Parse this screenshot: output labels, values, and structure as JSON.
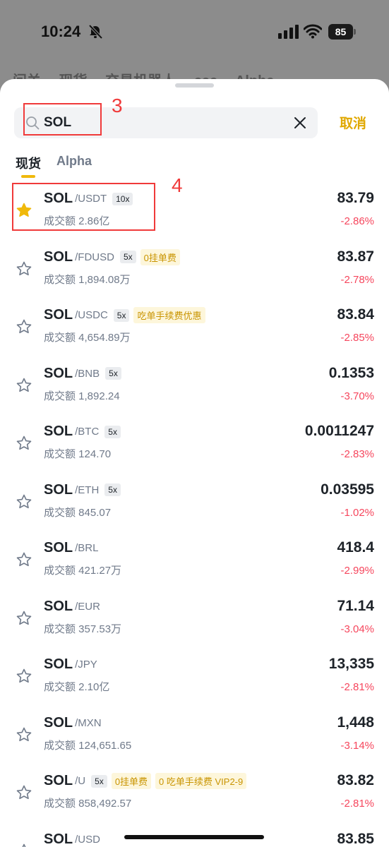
{
  "status_bar": {
    "time": "10:24",
    "battery": "85"
  },
  "background_tabs": [
    "问关",
    "现货",
    "交易机器人",
    "ccc",
    "Alpha"
  ],
  "search": {
    "value": "SOL",
    "placeholder": "",
    "cancel_label": "取消"
  },
  "annotations": {
    "search_marker": "3",
    "first_row_marker": "4"
  },
  "tabs": [
    {
      "label": "现货",
      "active": true
    },
    {
      "label": "Alpha",
      "active": false
    }
  ],
  "colors": {
    "accent": "#f0b90b",
    "down": "#f6465d",
    "tag_text": "#c99400",
    "annotation": "#f03a3a"
  },
  "pairs": [
    {
      "base": "SOL",
      "quote": "/USDT",
      "leverage": "10x",
      "tags": [],
      "volume": "成交额 2.86亿",
      "price": "83.79",
      "change": "-2.86%",
      "favorite": true
    },
    {
      "base": "SOL",
      "quote": "/FDUSD",
      "leverage": "5x",
      "tags": [
        "0挂单费"
      ],
      "volume": "成交额 1,894.08万",
      "price": "83.87",
      "change": "-2.78%",
      "favorite": false
    },
    {
      "base": "SOL",
      "quote": "/USDC",
      "leverage": "5x",
      "tags": [
        "吃单手续费优惠"
      ],
      "volume": "成交额 4,654.89万",
      "price": "83.84",
      "change": "-2.85%",
      "favorite": false
    },
    {
      "base": "SOL",
      "quote": "/BNB",
      "leverage": "5x",
      "tags": [],
      "volume": "成交额 1,892.24",
      "price": "0.1353",
      "change": "-3.70%",
      "favorite": false
    },
    {
      "base": "SOL",
      "quote": "/BTC",
      "leverage": "5x",
      "tags": [],
      "volume": "成交额 124.70",
      "price": "0.0011247",
      "change": "-2.83%",
      "favorite": false
    },
    {
      "base": "SOL",
      "quote": "/ETH",
      "leverage": "5x",
      "tags": [],
      "volume": "成交额 845.07",
      "price": "0.03595",
      "change": "-1.02%",
      "favorite": false
    },
    {
      "base": "SOL",
      "quote": "/BRL",
      "leverage": "",
      "tags": [],
      "volume": "成交额 421.27万",
      "price": "418.4",
      "change": "-2.99%",
      "favorite": false
    },
    {
      "base": "SOL",
      "quote": "/EUR",
      "leverage": "",
      "tags": [],
      "volume": "成交额 357.53万",
      "price": "71.14",
      "change": "-3.04%",
      "favorite": false
    },
    {
      "base": "SOL",
      "quote": "/JPY",
      "leverage": "",
      "tags": [],
      "volume": "成交额 2.10亿",
      "price": "13,335",
      "change": "-2.81%",
      "favorite": false
    },
    {
      "base": "SOL",
      "quote": "/MXN",
      "leverage": "",
      "tags": [],
      "volume": "成交额 124,651.65",
      "price": "1,448",
      "change": "-3.14%",
      "favorite": false
    },
    {
      "base": "SOL",
      "quote": "/U",
      "leverage": "5x",
      "tags": [
        "0挂单费",
        "0 吃单手续费 VIP2-9"
      ],
      "volume": "成交额 858,492.57",
      "price": "83.82",
      "change": "-2.81%",
      "favorite": false
    },
    {
      "base": "SOL",
      "quote": "/USD",
      "leverage": "",
      "tags": [],
      "volume": "",
      "price": "83.85",
      "change": "",
      "favorite": false
    }
  ]
}
